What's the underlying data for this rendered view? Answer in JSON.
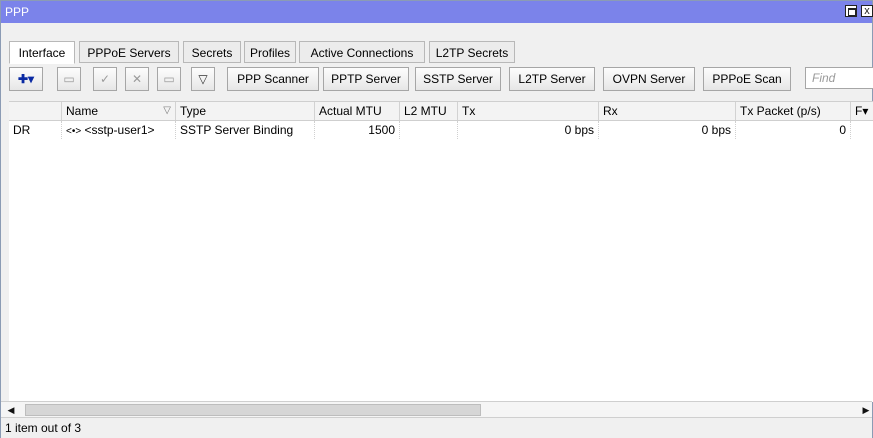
{
  "window": {
    "title": "PPP",
    "close_glyph": "x"
  },
  "tabs": [
    {
      "label": "Interface",
      "active": true
    },
    {
      "label": "PPPoE Servers",
      "active": false
    },
    {
      "label": "Secrets",
      "active": false
    },
    {
      "label": "Profiles",
      "active": false
    },
    {
      "label": "Active Connections",
      "active": false
    },
    {
      "label": "L2TP Secrets",
      "active": false
    }
  ],
  "toolbar": {
    "add_icon": "plus-dropdown-icon",
    "add_glyph": "✚▾",
    "remove_icon": "minus-icon",
    "remove_glyph": "▭",
    "enable_icon": "check-icon",
    "enable_glyph": "✓",
    "disable_icon": "x-icon",
    "disable_glyph": "✕",
    "comment_icon": "comment-icon",
    "comment_glyph": "▭",
    "filter_icon": "filter-icon",
    "filter_glyph": "▽",
    "buttons": [
      "PPP Scanner",
      "PPTP Server",
      "SSTP Server",
      "L2TP Server",
      "OVPN Server",
      "PPPoE Scan"
    ],
    "find_placeholder": "Find"
  },
  "table": {
    "columns": [
      "",
      "Name",
      "Type",
      "Actual MTU",
      "L2 MTU",
      "Tx",
      "Rx",
      "Tx Packet (p/s)",
      "F"
    ],
    "sort_glyph": "▽",
    "menu_glyph": "▾",
    "rows": [
      {
        "flags": "DR",
        "name_icon": "<•>",
        "name": "<sstp-user1>",
        "type": "SSTP Server Binding",
        "actual_mtu": "1500",
        "l2_mtu": "",
        "tx": "0 bps",
        "rx": "0 bps",
        "tx_packet": "0"
      }
    ]
  },
  "scrollbar": {
    "left_glyph": "◀",
    "right_glyph": "▶"
  },
  "status": {
    "text": "1 item out of 3"
  },
  "colors": {
    "titlebar": "#7b83ea",
    "add_icon": "#0a2aa3"
  }
}
